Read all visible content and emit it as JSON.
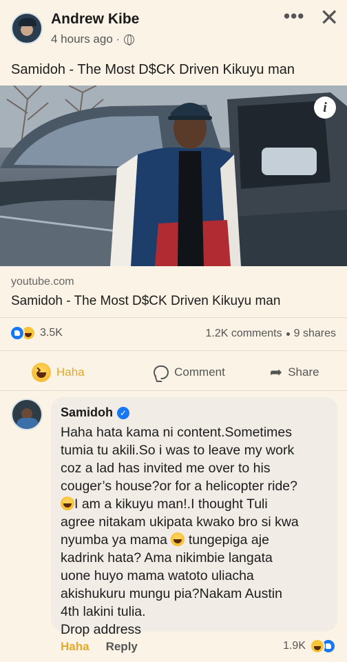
{
  "post": {
    "author": "Andrew Kibe",
    "time": "4 hours ago ·",
    "text": "Samidoh - The Most D$CK Driven Kikuyu man",
    "link": {
      "domain": "youtube.com",
      "title": "Samidoh - The Most D$CK Driven Kikuyu man",
      "info_badge": "i"
    }
  },
  "stats": {
    "reactions": "3.5K",
    "comments": "1.2K comments",
    "shares": "9 shares"
  },
  "actions": {
    "haha": "Haha",
    "comment": "Comment",
    "share": "Share"
  },
  "comment": {
    "author": "Samidoh",
    "lines": [
      "Haha hata kama ni content.Sometimes",
      "tumia tu akili.So i was to leave my work",
      "coz a lad has invited me over to his",
      "couger’s house?or for a helicopter ride?",
      "I am a kikuyu man!.I thought Tuli",
      "agree nitakam ukipata kwako bro si kwa",
      "nyumba ya mama",
      "tungepiga aje",
      "kadrink hata? Ama nikimbie langata",
      "uone huyo mama watoto uliacha",
      "akishukuru mungu pia?Nakam Austin",
      "4th lakini tulia.",
      "Drop address"
    ],
    "haha": "Haha",
    "reply": "Reply",
    "reactions": "1.9K"
  },
  "icons": {
    "more": "more-icon",
    "close": "close-icon",
    "globe": "globe-icon",
    "verified": "verified-icon"
  },
  "colors": {
    "background": "#faf3e6",
    "haha": "#e3a92a",
    "like": "#1877f2"
  }
}
